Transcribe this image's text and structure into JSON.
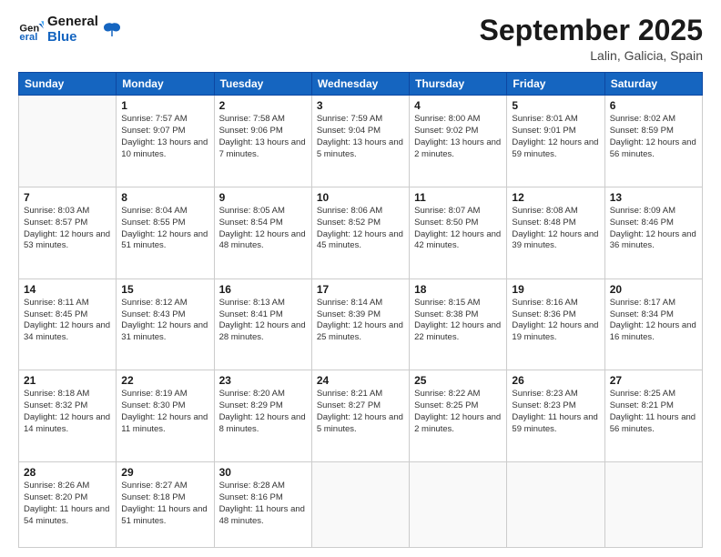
{
  "header": {
    "logo_general": "General",
    "logo_blue": "Blue",
    "month_title": "September 2025",
    "location": "Lalin, Galicia, Spain"
  },
  "weekdays": [
    "Sunday",
    "Monday",
    "Tuesday",
    "Wednesday",
    "Thursday",
    "Friday",
    "Saturday"
  ],
  "weeks": [
    [
      {
        "day": null
      },
      {
        "day": 1,
        "sunrise": "7:57 AM",
        "sunset": "9:07 PM",
        "daylight": "13 hours and 10 minutes."
      },
      {
        "day": 2,
        "sunrise": "7:58 AM",
        "sunset": "9:06 PM",
        "daylight": "13 hours and 7 minutes."
      },
      {
        "day": 3,
        "sunrise": "7:59 AM",
        "sunset": "9:04 PM",
        "daylight": "13 hours and 5 minutes."
      },
      {
        "day": 4,
        "sunrise": "8:00 AM",
        "sunset": "9:02 PM",
        "daylight": "13 hours and 2 minutes."
      },
      {
        "day": 5,
        "sunrise": "8:01 AM",
        "sunset": "9:01 PM",
        "daylight": "12 hours and 59 minutes."
      },
      {
        "day": 6,
        "sunrise": "8:02 AM",
        "sunset": "8:59 PM",
        "daylight": "12 hours and 56 minutes."
      }
    ],
    [
      {
        "day": 7,
        "sunrise": "8:03 AM",
        "sunset": "8:57 PM",
        "daylight": "12 hours and 53 minutes."
      },
      {
        "day": 8,
        "sunrise": "8:04 AM",
        "sunset": "8:55 PM",
        "daylight": "12 hours and 51 minutes."
      },
      {
        "day": 9,
        "sunrise": "8:05 AM",
        "sunset": "8:54 PM",
        "daylight": "12 hours and 48 minutes."
      },
      {
        "day": 10,
        "sunrise": "8:06 AM",
        "sunset": "8:52 PM",
        "daylight": "12 hours and 45 minutes."
      },
      {
        "day": 11,
        "sunrise": "8:07 AM",
        "sunset": "8:50 PM",
        "daylight": "12 hours and 42 minutes."
      },
      {
        "day": 12,
        "sunrise": "8:08 AM",
        "sunset": "8:48 PM",
        "daylight": "12 hours and 39 minutes."
      },
      {
        "day": 13,
        "sunrise": "8:09 AM",
        "sunset": "8:46 PM",
        "daylight": "12 hours and 36 minutes."
      }
    ],
    [
      {
        "day": 14,
        "sunrise": "8:11 AM",
        "sunset": "8:45 PM",
        "daylight": "12 hours and 34 minutes."
      },
      {
        "day": 15,
        "sunrise": "8:12 AM",
        "sunset": "8:43 PM",
        "daylight": "12 hours and 31 minutes."
      },
      {
        "day": 16,
        "sunrise": "8:13 AM",
        "sunset": "8:41 PM",
        "daylight": "12 hours and 28 minutes."
      },
      {
        "day": 17,
        "sunrise": "8:14 AM",
        "sunset": "8:39 PM",
        "daylight": "12 hours and 25 minutes."
      },
      {
        "day": 18,
        "sunrise": "8:15 AM",
        "sunset": "8:38 PM",
        "daylight": "12 hours and 22 minutes."
      },
      {
        "day": 19,
        "sunrise": "8:16 AM",
        "sunset": "8:36 PM",
        "daylight": "12 hours and 19 minutes."
      },
      {
        "day": 20,
        "sunrise": "8:17 AM",
        "sunset": "8:34 PM",
        "daylight": "12 hours and 16 minutes."
      }
    ],
    [
      {
        "day": 21,
        "sunrise": "8:18 AM",
        "sunset": "8:32 PM",
        "daylight": "12 hours and 14 minutes."
      },
      {
        "day": 22,
        "sunrise": "8:19 AM",
        "sunset": "8:30 PM",
        "daylight": "12 hours and 11 minutes."
      },
      {
        "day": 23,
        "sunrise": "8:20 AM",
        "sunset": "8:29 PM",
        "daylight": "12 hours and 8 minutes."
      },
      {
        "day": 24,
        "sunrise": "8:21 AM",
        "sunset": "8:27 PM",
        "daylight": "12 hours and 5 minutes."
      },
      {
        "day": 25,
        "sunrise": "8:22 AM",
        "sunset": "8:25 PM",
        "daylight": "12 hours and 2 minutes."
      },
      {
        "day": 26,
        "sunrise": "8:23 AM",
        "sunset": "8:23 PM",
        "daylight": "11 hours and 59 minutes."
      },
      {
        "day": 27,
        "sunrise": "8:25 AM",
        "sunset": "8:21 PM",
        "daylight": "11 hours and 56 minutes."
      }
    ],
    [
      {
        "day": 28,
        "sunrise": "8:26 AM",
        "sunset": "8:20 PM",
        "daylight": "11 hours and 54 minutes."
      },
      {
        "day": 29,
        "sunrise": "8:27 AM",
        "sunset": "8:18 PM",
        "daylight": "11 hours and 51 minutes."
      },
      {
        "day": 30,
        "sunrise": "8:28 AM",
        "sunset": "8:16 PM",
        "daylight": "11 hours and 48 minutes."
      },
      {
        "day": null
      },
      {
        "day": null
      },
      {
        "day": null
      },
      {
        "day": null
      }
    ]
  ]
}
